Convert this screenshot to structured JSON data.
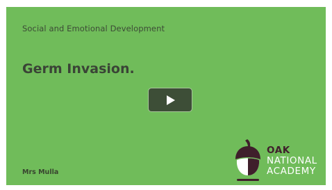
{
  "slide": {
    "subject": "Social and Emotional Development",
    "title": "Germ Invasion.",
    "teacher": "Mrs Mulla"
  },
  "player": {
    "play_icon": "play-icon"
  },
  "logo": {
    "line1": "OAK",
    "line2": "NATIONAL",
    "line3": "ACADEMY"
  },
  "colors": {
    "slide_background": "#70bc5a",
    "play_button": "#3d4e37",
    "acorn": "#3f1f2b",
    "logo_text": "#ffffff"
  }
}
